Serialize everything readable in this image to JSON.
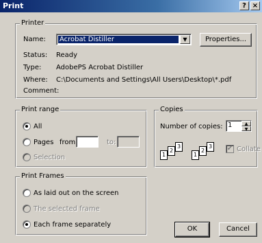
{
  "window": {
    "title": "Print",
    "help_label": "?",
    "close_label": "×"
  },
  "printer": {
    "legend": "Printer",
    "name_label": "Name:",
    "name_value": "Acrobat Distiller",
    "properties_label": "Properties...",
    "status_label": "Status:",
    "status_value": "Ready",
    "type_label": "Type:",
    "type_value": "AdobePS Acrobat Distiller",
    "where_label": "Where:",
    "where_value": "C:\\Documents and Settings\\All Users\\Desktop\\*.pdf",
    "comment_label": "Comment:",
    "comment_value": ""
  },
  "print_range": {
    "legend": "Print range",
    "all_label": "All",
    "pages_label": "Pages",
    "from_label": "from:",
    "from_value": "",
    "to_label": "to:",
    "to_value": "",
    "selection_label": "Selection",
    "selected": "all"
  },
  "copies": {
    "legend": "Copies",
    "number_label": "Number of copies:",
    "number_value": "1",
    "collate_label": "Collate",
    "collate_checked": true,
    "collate_disabled": true,
    "page_numbers": [
      "1",
      "2",
      "3"
    ]
  },
  "print_frames": {
    "legend": "Print Frames",
    "option_screen": "As laid out on the screen",
    "option_selected_frame": "The selected frame",
    "option_each_frame": "Each frame separately",
    "selected": "each_frame"
  },
  "buttons": {
    "ok_label": "OK",
    "cancel_label": "Cancel"
  }
}
